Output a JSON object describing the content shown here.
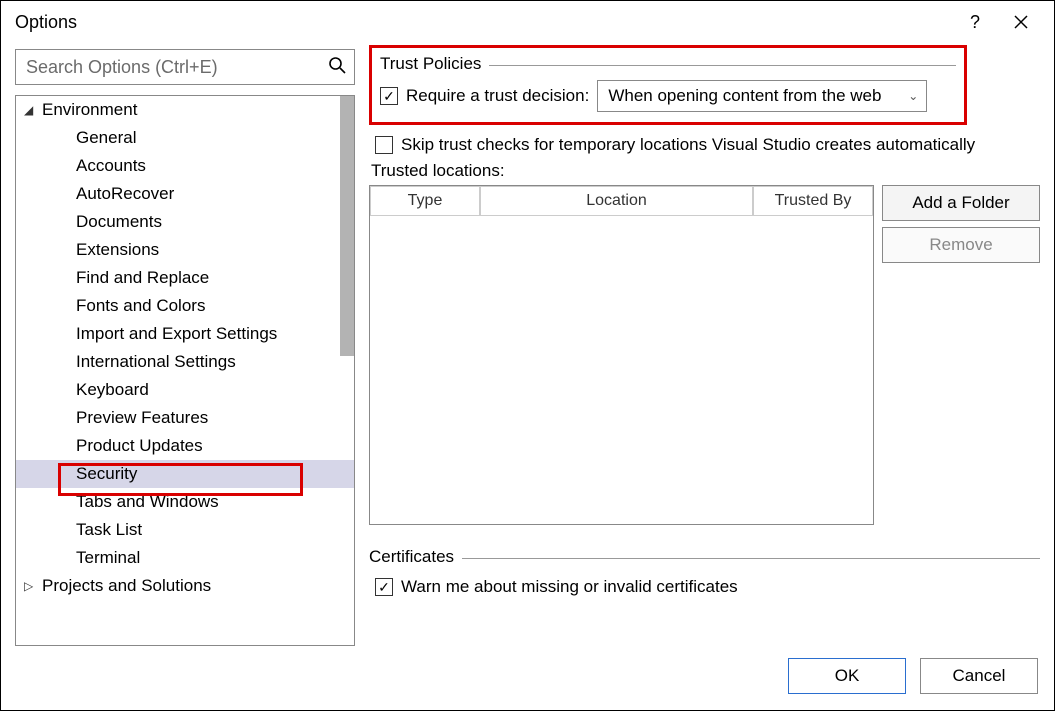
{
  "title": "Options",
  "search": {
    "placeholder": "Search Options (Ctrl+E)"
  },
  "tree": {
    "parent1": "Environment",
    "items": [
      "General",
      "Accounts",
      "AutoRecover",
      "Documents",
      "Extensions",
      "Find and Replace",
      "Fonts and Colors",
      "Import and Export Settings",
      "International Settings",
      "Keyboard",
      "Preview Features",
      "Product Updates",
      "Security",
      "Tabs and Windows",
      "Task List",
      "Terminal"
    ],
    "parent2": "Projects and Solutions"
  },
  "trust": {
    "group": "Trust Policies",
    "require_label": "Require a trust decision:",
    "select_value": "When opening content from the web",
    "skip_label": "Skip trust checks for temporary locations Visual Studio creates automatically",
    "locations_label": "Trusted locations:",
    "cols": {
      "type": "Type",
      "location": "Location",
      "trustedby": "Trusted By"
    },
    "add_btn": "Add a Folder",
    "remove_btn": "Remove"
  },
  "cert": {
    "group": "Certificates",
    "warn_label": "Warn me about missing or invalid certificates"
  },
  "buttons": {
    "ok": "OK",
    "cancel": "Cancel"
  }
}
